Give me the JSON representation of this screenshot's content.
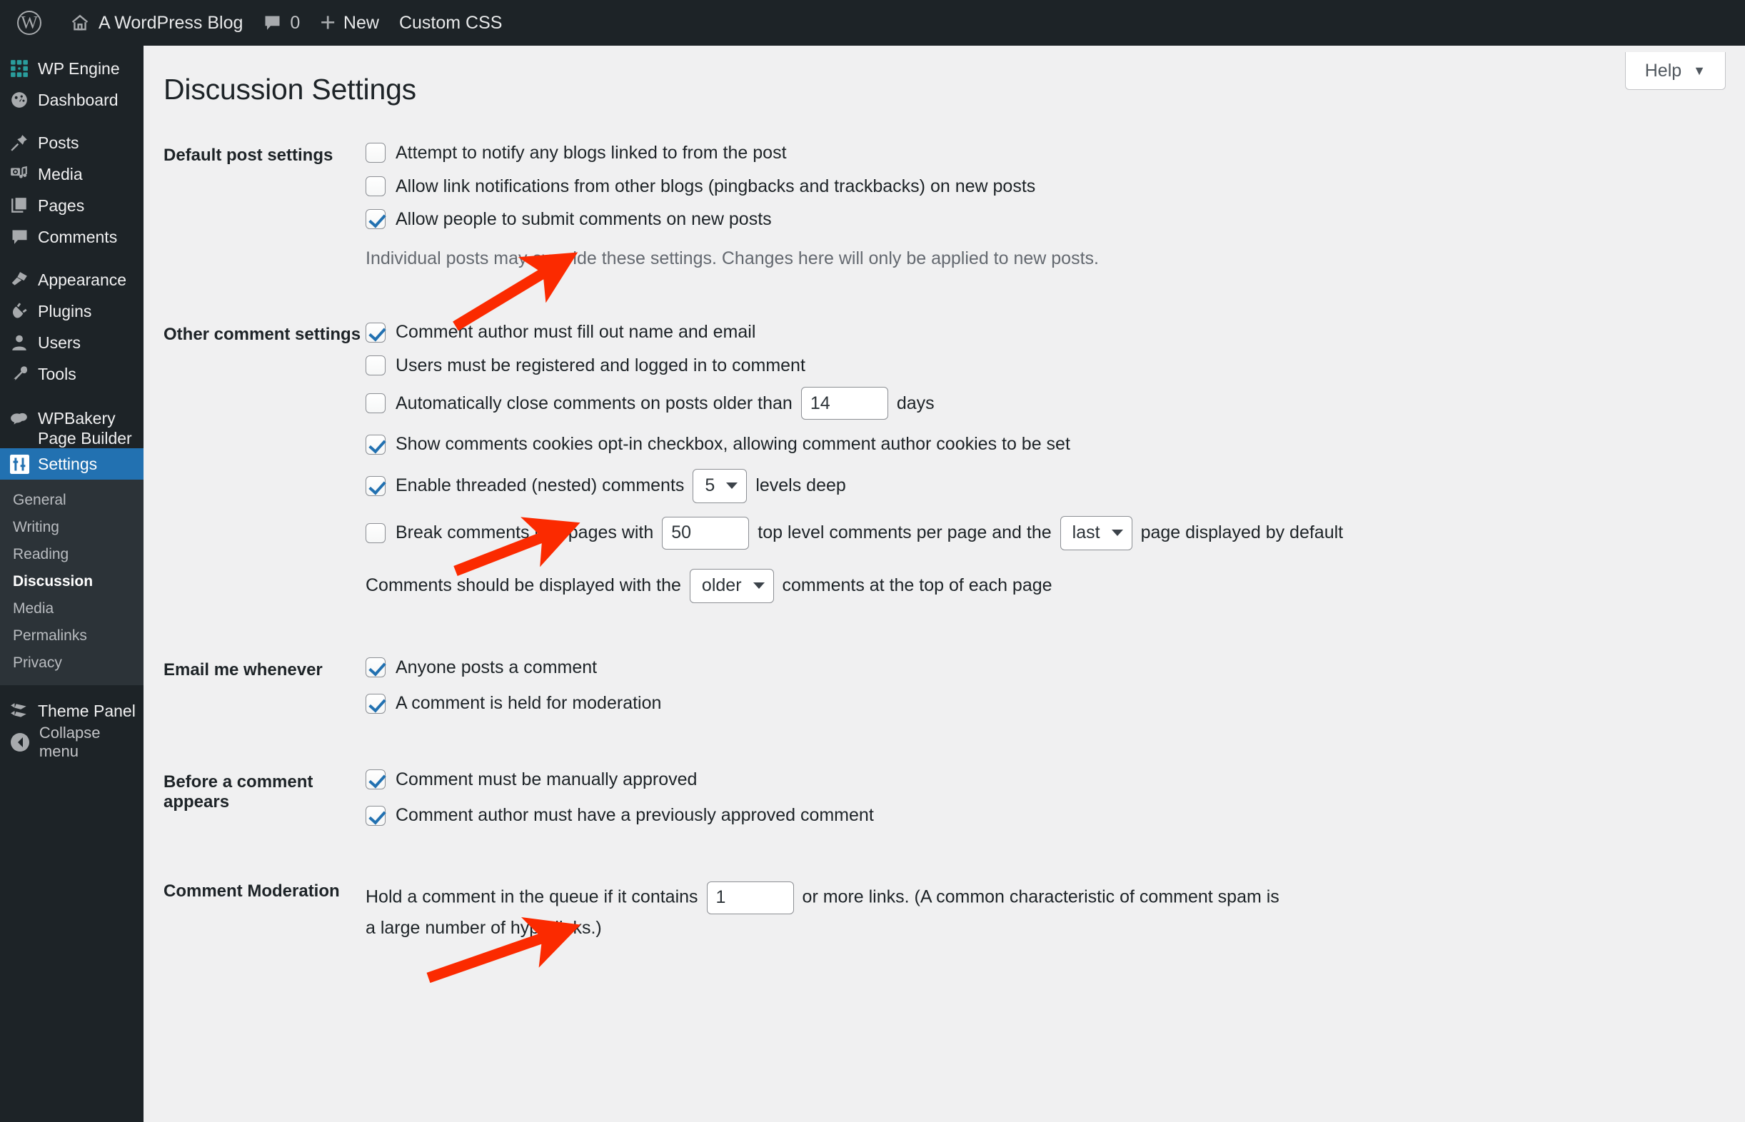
{
  "adminbar": {
    "logo_icon": "wordpress-logo-icon",
    "site_icon": "home-icon",
    "site_name": "A WordPress Blog",
    "comments_icon": "comment-bubble-icon",
    "comments_count": "0",
    "new_icon": "plus-icon",
    "new_label": "New",
    "custom_css_label": "Custom CSS"
  },
  "sidebar": {
    "items": [
      {
        "label": "WP Engine",
        "icon": "wp-engine-grid-icon"
      },
      {
        "label": "Dashboard",
        "icon": "dashboard-gauge-icon"
      },
      {
        "label": "Posts",
        "icon": "pushpin-icon"
      },
      {
        "label": "Media",
        "icon": "media-camera-music-icon"
      },
      {
        "label": "Pages",
        "icon": "pages-stack-icon"
      },
      {
        "label": "Comments",
        "icon": "comment-bubble-icon"
      },
      {
        "label": "Appearance",
        "icon": "paintbrush-icon"
      },
      {
        "label": "Plugins",
        "icon": "plug-icon"
      },
      {
        "label": "Users",
        "icon": "user-icon"
      },
      {
        "label": "Tools",
        "icon": "wrench-icon"
      },
      {
        "label": "WPBakery Page Builder",
        "icon": "wpbakery-cloud-icon"
      },
      {
        "label": "Settings",
        "icon": "settings-sliders-icon"
      }
    ],
    "submenu": [
      {
        "label": "General"
      },
      {
        "label": "Writing"
      },
      {
        "label": "Reading"
      },
      {
        "label": "Discussion"
      },
      {
        "label": "Media"
      },
      {
        "label": "Permalinks"
      },
      {
        "label": "Privacy"
      }
    ],
    "active_submenu": "Discussion",
    "theme_panel": {
      "label": "Theme Panel",
      "icon": "theme-panel-layers-icon"
    },
    "collapse": {
      "label": "Collapse menu",
      "icon": "collapse-arrow-left-icon"
    },
    "accent_current": "#2271b1",
    "background": "#1d2327"
  },
  "help": {
    "label": "Help",
    "caret": "▼"
  },
  "page": {
    "title": "Discussion Settings"
  },
  "sections": {
    "default_post": {
      "heading": "Default post settings",
      "options": [
        {
          "label": "Attempt to notify any blogs linked to from the post",
          "checked": false
        },
        {
          "label": "Allow link notifications from other blogs (pingbacks and trackbacks) on new posts",
          "checked": false
        },
        {
          "label": "Allow people to submit comments on new posts",
          "checked": true
        }
      ],
      "help": "Individual posts may override these settings. Changes here will only be applied to new posts."
    },
    "other_comment": {
      "heading": "Other comment settings",
      "opt_name_email": {
        "label": "Comment author must fill out name and email",
        "checked": true
      },
      "opt_registered": {
        "label": "Users must be registered and logged in to comment",
        "checked": false
      },
      "opt_autoclose": {
        "label_before": "Automatically close comments on posts older than",
        "value": "14",
        "label_after": "days",
        "checked": false
      },
      "opt_cookies": {
        "label": "Show comments cookies opt-in checkbox, allowing comment author cookies to be set",
        "checked": true
      },
      "opt_threaded": {
        "label_before": "Enable threaded (nested) comments",
        "value": "5",
        "label_after": "levels deep",
        "checked": true
      },
      "opt_break_pages": {
        "label_before": "Break comments into pages with",
        "value": "50",
        "label_mid": "top level comments per page and the",
        "page_value": "last",
        "label_after": "page displayed by default",
        "checked": false
      },
      "display_order": {
        "label_before": "Comments should be displayed with the",
        "value": "older",
        "label_after": "comments at the top of each page"
      }
    },
    "email_me": {
      "heading": "Email me whenever",
      "options": [
        {
          "label": "Anyone posts a comment",
          "checked": true
        },
        {
          "label": "A comment is held for moderation",
          "checked": true
        }
      ]
    },
    "before_appears": {
      "heading": "Before a comment appears",
      "options": [
        {
          "label": "Comment must be manually approved",
          "checked": true
        },
        {
          "label": "Comment author must have a previously approved comment",
          "checked": true
        }
      ]
    },
    "moderation": {
      "heading": "Comment Moderation",
      "text_before": "Hold a comment in the queue if it contains",
      "value": "1",
      "text_after": "or more links. (A common characteristic of comment spam is a large number of hyperlinks.)"
    }
  },
  "annotations": {
    "color": "#fb2a00",
    "arrows": [
      {
        "name": "arrow-allow-comments"
      },
      {
        "name": "arrow-cookies-optin"
      },
      {
        "name": "arrow-manual-approval"
      }
    ]
  }
}
